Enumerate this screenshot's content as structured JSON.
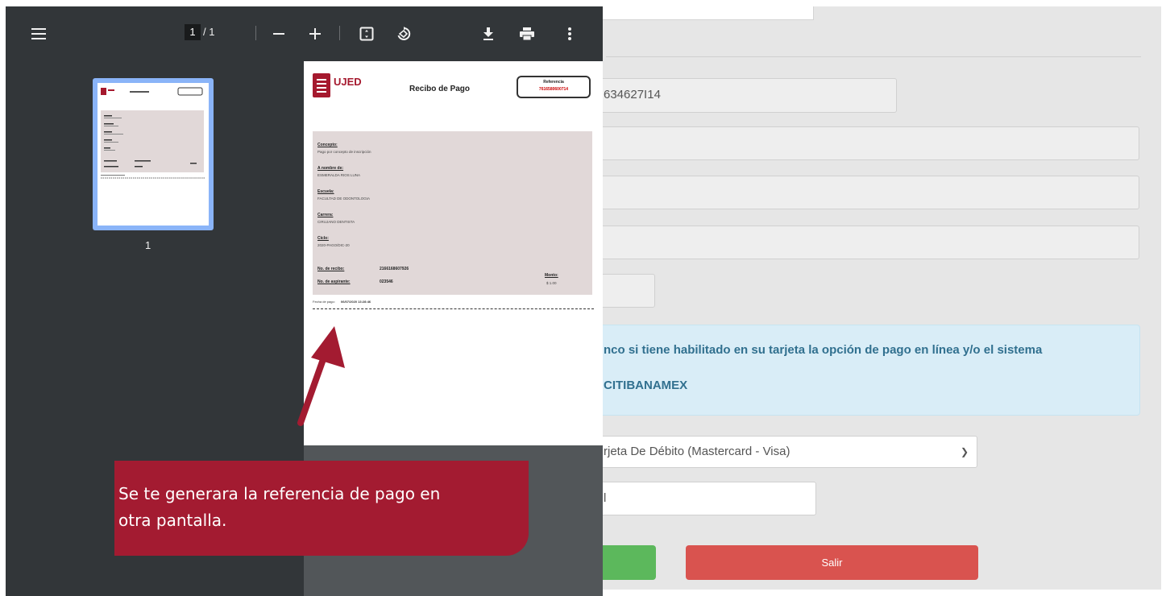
{
  "viewer": {
    "current_page": "1",
    "page_separator": "/",
    "total_pages": "1",
    "thumbnail_label": "1",
    "icons": [
      "menu-icon",
      "zoom-out-icon",
      "zoom-in-icon",
      "fit-page-icon",
      "rotate-icon",
      "download-icon",
      "print-icon",
      "more-vert-icon"
    ]
  },
  "receipt": {
    "logo": "UJED",
    "title": "Recibo de Pago",
    "reference_label": "Referencia",
    "reference_value": "7616580600714",
    "concepto_label": "Concepto:",
    "concepto_value": "Pago por concepto de inscripción",
    "nombre_label": "A nombre de:",
    "nombre_value": "ESMERALDA RIOS LUNA",
    "escuela_label": "Escuela:",
    "escuela_value": "FACULTAD DE ODONTOLOGIA",
    "carrera_label": "Carrera:",
    "carrera_value": "CIRUJANO DENTISTA",
    "ciclo_label": "Ciclo:",
    "ciclo_value": "2020-PAGO/DIC-20",
    "recibo_label": "No. de recibo:",
    "recibo_value": "2166168607926",
    "aspirante_label": "No. de aspirante:",
    "aspirante_value": "023546",
    "monto_label": "Monto:",
    "monto_value": "$ 1.00",
    "fecha_label": "Fecha de pago:",
    "fecha_value": "06/07/2020 13:28:46"
  },
  "form": {
    "reference_value": "634627I14",
    "alert_line1": "nco si tiene habilitado en su tarjeta la opción de pago en línea y/o el sistema",
    "alert_line2": "CITIBANAMEX",
    "payment_select": "rjeta De Débito (Mastercard - Visa)",
    "last_field": "l",
    "exit_button": "Salir",
    "colors": {
      "alert_bg": "#d9edf7",
      "alert_text": "#31708f",
      "success": "#5cb85c",
      "danger": "#d9534f"
    }
  },
  "callout": {
    "line1": "Se te generara la referencia de pago en",
    "line2": "otra pantalla.",
    "color": "#a31b31"
  }
}
